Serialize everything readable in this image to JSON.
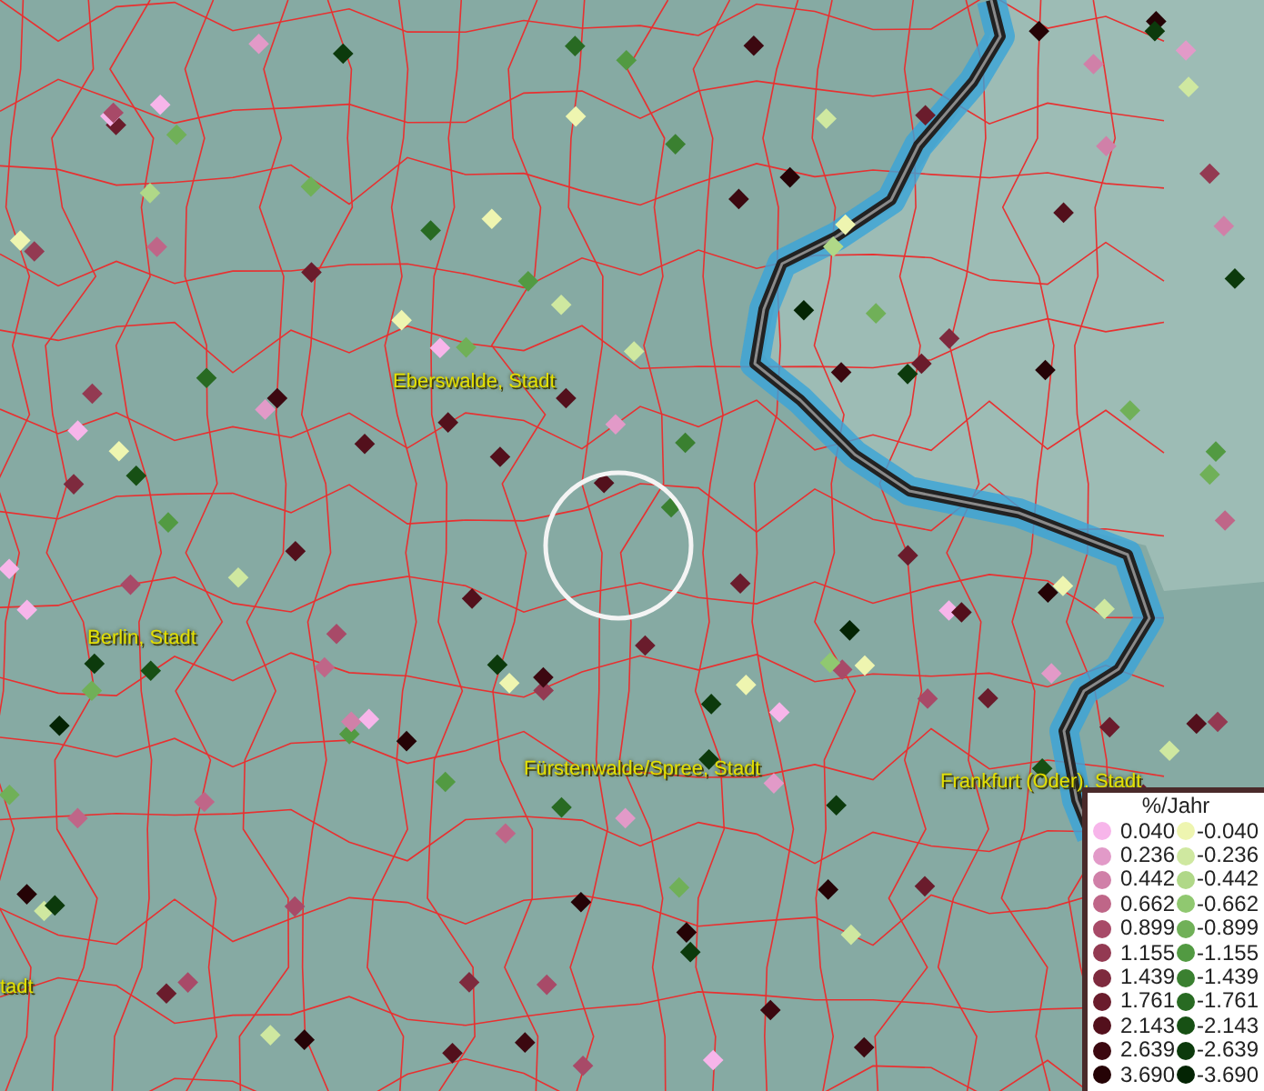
{
  "map": {
    "place_labels": [
      {
        "text": "Eberswalde, Stadt"
      },
      {
        "text": "Berlin, Stadt"
      },
      {
        "text": "Fürstenwalde/Spree, Stadt"
      },
      {
        "text": "Frankfurt (Oder), Stadt"
      },
      {
        "text": "tadt"
      }
    ],
    "legend": {
      "title": "%/Jahr",
      "items": [
        {
          "positive": {
            "label": "0.040",
            "color": "#f7b5ea"
          },
          "negative": {
            "label": "-0.040",
            "color": "#eef5b0"
          }
        },
        {
          "positive": {
            "label": "0.236",
            "color": "#e29ac8"
          },
          "negative": {
            "label": "-0.236",
            "color": "#cfe8a0"
          }
        },
        {
          "positive": {
            "label": "0.442",
            "color": "#d080a8"
          },
          "negative": {
            "label": "-0.442",
            "color": "#b0d888"
          }
        },
        {
          "positive": {
            "label": "0.662",
            "color": "#bf6688"
          },
          "negative": {
            "label": "-0.662",
            "color": "#90c870"
          }
        },
        {
          "positive": {
            "label": "0.899",
            "color": "#a84a68"
          },
          "negative": {
            "label": "-0.899",
            "color": "#70b058"
          }
        },
        {
          "positive": {
            "label": "1.155",
            "color": "#933a52"
          },
          "negative": {
            "label": "-1.155",
            "color": "#529a42"
          }
        },
        {
          "positive": {
            "label": "1.439",
            "color": "#7e2a3e"
          },
          "negative": {
            "label": "-1.439",
            "color": "#3a8030"
          }
        },
        {
          "positive": {
            "label": "1.761",
            "color": "#6a1c2c"
          },
          "negative": {
            "label": "-1.761",
            "color": "#286a22"
          }
        },
        {
          "positive": {
            "label": "2.143",
            "color": "#53101c"
          },
          "negative": {
            "label": "-2.143",
            "color": "#175014"
          }
        },
        {
          "positive": {
            "label": "2.639",
            "color": "#3c0810"
          },
          "negative": {
            "label": "-2.639",
            "color": "#0c3a0c"
          }
        },
        {
          "positive": {
            "label": "3.690",
            "color": "#250306"
          },
          "negative": {
            "label": "-3.690",
            "color": "#042404"
          }
        }
      ]
    }
  }
}
